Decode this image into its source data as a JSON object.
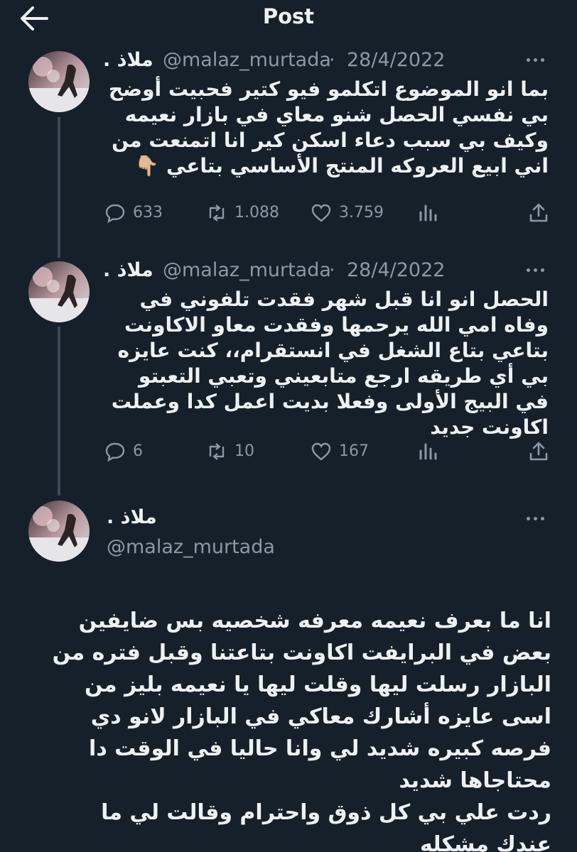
{
  "header": {
    "title": "Post",
    "back_icon": "arrow-left-icon"
  },
  "thread": [
    {
      "display_name": "ملاذ .",
      "handle": "@malaz_murtada",
      "separator": "·",
      "date": "28/4/2022",
      "text": "بما انو الموضوع اتكلمو فيو كتير فحبيت أوضح بي نفسي الحصل شنو معاي في بازار نعيمه وكيف بي سبب دعاء اسكن كير انا اتمنعت من اني ابيع العروكه المنتج الأساسي بتاعي 👇🏼",
      "replies": "633",
      "reposts": "1.088",
      "likes": "3.759"
    },
    {
      "display_name": "ملاذ .",
      "handle": "@malaz_murtada",
      "separator": "·",
      "date": "28/4/2022",
      "text": "الحصل انو انا قبل شهر فقدت تلفوني في وفاه امي الله يرحمها وفقدت معاو الاكاونت بتاعي بتاع الشغل في انستقرام،، كنت عايزه بي أي طريقه ارجع متابعيني وتعبي التعبتو في البيج الأولى وفعلا بديت اعمل كدا وعملت اكاونت جديد",
      "replies": "6",
      "reposts": "10",
      "likes": "167"
    }
  ],
  "main_post": {
    "display_name": "ملاذ .",
    "handle": "@malaz_murtada",
    "text": "انا ما بعرف نعيمه معرفه شخصيه بس ضايفين بعض في البرايفت اكاونت بتاعتنا وقبل فتره من البازار رسلت ليها وقلت ليها يا نعيمه بليز من اسى عايزه أشارك معاكي في البازار لانو دي فرصه كبيره شديد لي وانا حاليا في الوقت دا محتاجاها شديد\nردت علي بي كل ذوق واحترام وقالت لي ما عندك مشكله"
  },
  "colors": {
    "background": "#15202b",
    "text": "#e7e9ea",
    "secondary": "#8b98a5",
    "thread_line": "#3b4a58"
  }
}
